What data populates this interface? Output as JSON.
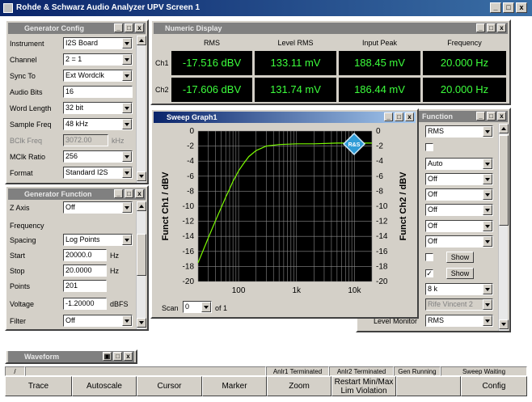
{
  "app": {
    "title": "Rohde & Schwarz Audio Analyzer UPV Screen 1"
  },
  "gen_config": {
    "title": "Generator Config",
    "rows": [
      {
        "label": "Instrument",
        "value": "I2S Board"
      },
      {
        "label": "Channel",
        "value": "2 = 1"
      },
      {
        "label": "Sync To",
        "value": "Ext Wordclk"
      },
      {
        "label": "Audio Bits",
        "value": "16"
      },
      {
        "label": "Word Length",
        "value": "32 bit"
      },
      {
        "label": "Sample Freq",
        "value": "48 kHz"
      },
      {
        "label": "BClk Freq",
        "value": "3072.00",
        "unit": "kHz"
      },
      {
        "label": "MClk Ratio",
        "value": "256"
      },
      {
        "label": "Format",
        "value": "Standard I2S"
      }
    ]
  },
  "gen_function": {
    "title": "Generator Function",
    "z_axis_label": "Z Axis",
    "z_axis_value": "Off",
    "frequency_section": "Frequency",
    "spacing_label": "Spacing",
    "spacing_value": "Log Points",
    "start_label": "Start",
    "start_value": "20000.0",
    "start_unit": "Hz",
    "stop_label": "Stop",
    "stop_value": "20.0000",
    "stop_unit": "Hz",
    "points_label": "Points",
    "points_value": "201",
    "voltage_label": "Voltage",
    "voltage_value": "-1.20000",
    "voltage_unit": "dBFS",
    "filter_label": "Filter",
    "filter_value": "Off"
  },
  "numeric_display": {
    "title": "Numeric Display",
    "headers": [
      "RMS",
      "Level RMS",
      "Input Peak",
      "Frequency"
    ],
    "rows": [
      {
        "label": "Ch1",
        "values": [
          "-17.516 dBV",
          "133.11 mV",
          "188.45 mV",
          "20.000 Hz"
        ]
      },
      {
        "label": "Ch2",
        "values": [
          "-17.606 dBV",
          "131.74 mV",
          "186.44 mV",
          "20.000 Hz"
        ]
      }
    ]
  },
  "analyzer_function": {
    "title_fragment": "Function",
    "values": [
      "RMS",
      "",
      "Auto",
      "Off",
      "Off",
      "Off",
      "Off",
      "Off",
      "",
      "",
      "8 k",
      "Rife Vincent 2",
      "RMS"
    ],
    "show1": "Show",
    "show2": "Show",
    "level_monitor_label": "Level Monitor"
  },
  "sweep_graph": {
    "title": "Sweep Graph1",
    "scan_label": "Scan",
    "scan_value": "0",
    "scan_of": "of 1",
    "logo_text": "R&S"
  },
  "chart_data": {
    "type": "line",
    "title": "",
    "xlabel": "Frequency / Hz",
    "ylabel": "Funct Ch1 / dBV",
    "y2label": "Funct Ch2 / dBV",
    "xscale": "log",
    "xlim": [
      20,
      20000
    ],
    "ylim": [
      -20,
      0
    ],
    "x_ticks": [
      100,
      1000,
      10000
    ],
    "x_tick_labels": [
      "100",
      "1k",
      "10k"
    ],
    "y_ticks": [
      0,
      -2,
      -4,
      -6,
      -8,
      -10,
      -12,
      -14,
      -16,
      -18,
      -20
    ],
    "grid": true,
    "series": [
      {
        "color": "#7cfc00",
        "x": [
          20,
          25,
          30,
          40,
          50,
          60,
          70,
          80,
          100,
          120,
          150,
          200,
          300,
          500,
          1000,
          2000,
          5000,
          10000,
          20000
        ],
        "y": [
          -17.5,
          -15.7,
          -14.2,
          -11.9,
          -10.2,
          -8.8,
          -7.7,
          -6.7,
          -5.3,
          -4.4,
          -3.4,
          -2.6,
          -2.0,
          -1.8,
          -1.7,
          -1.7,
          -1.6,
          -1.6,
          -1.6
        ]
      }
    ]
  },
  "waveform": {
    "title": "Waveform"
  },
  "statusbar": {
    "items": [
      "Anlr1 Terminated",
      "Anlr2 Terminated",
      "Gen Running",
      "Sweep Waiting"
    ]
  },
  "softkeys": {
    "marker_glyph": "/",
    "labels": [
      "Trace",
      "Autoscale",
      "Cursor",
      "Marker",
      "Zoom",
      "Restart Min/Max",
      "Lim Violation",
      "",
      "Config"
    ]
  }
}
